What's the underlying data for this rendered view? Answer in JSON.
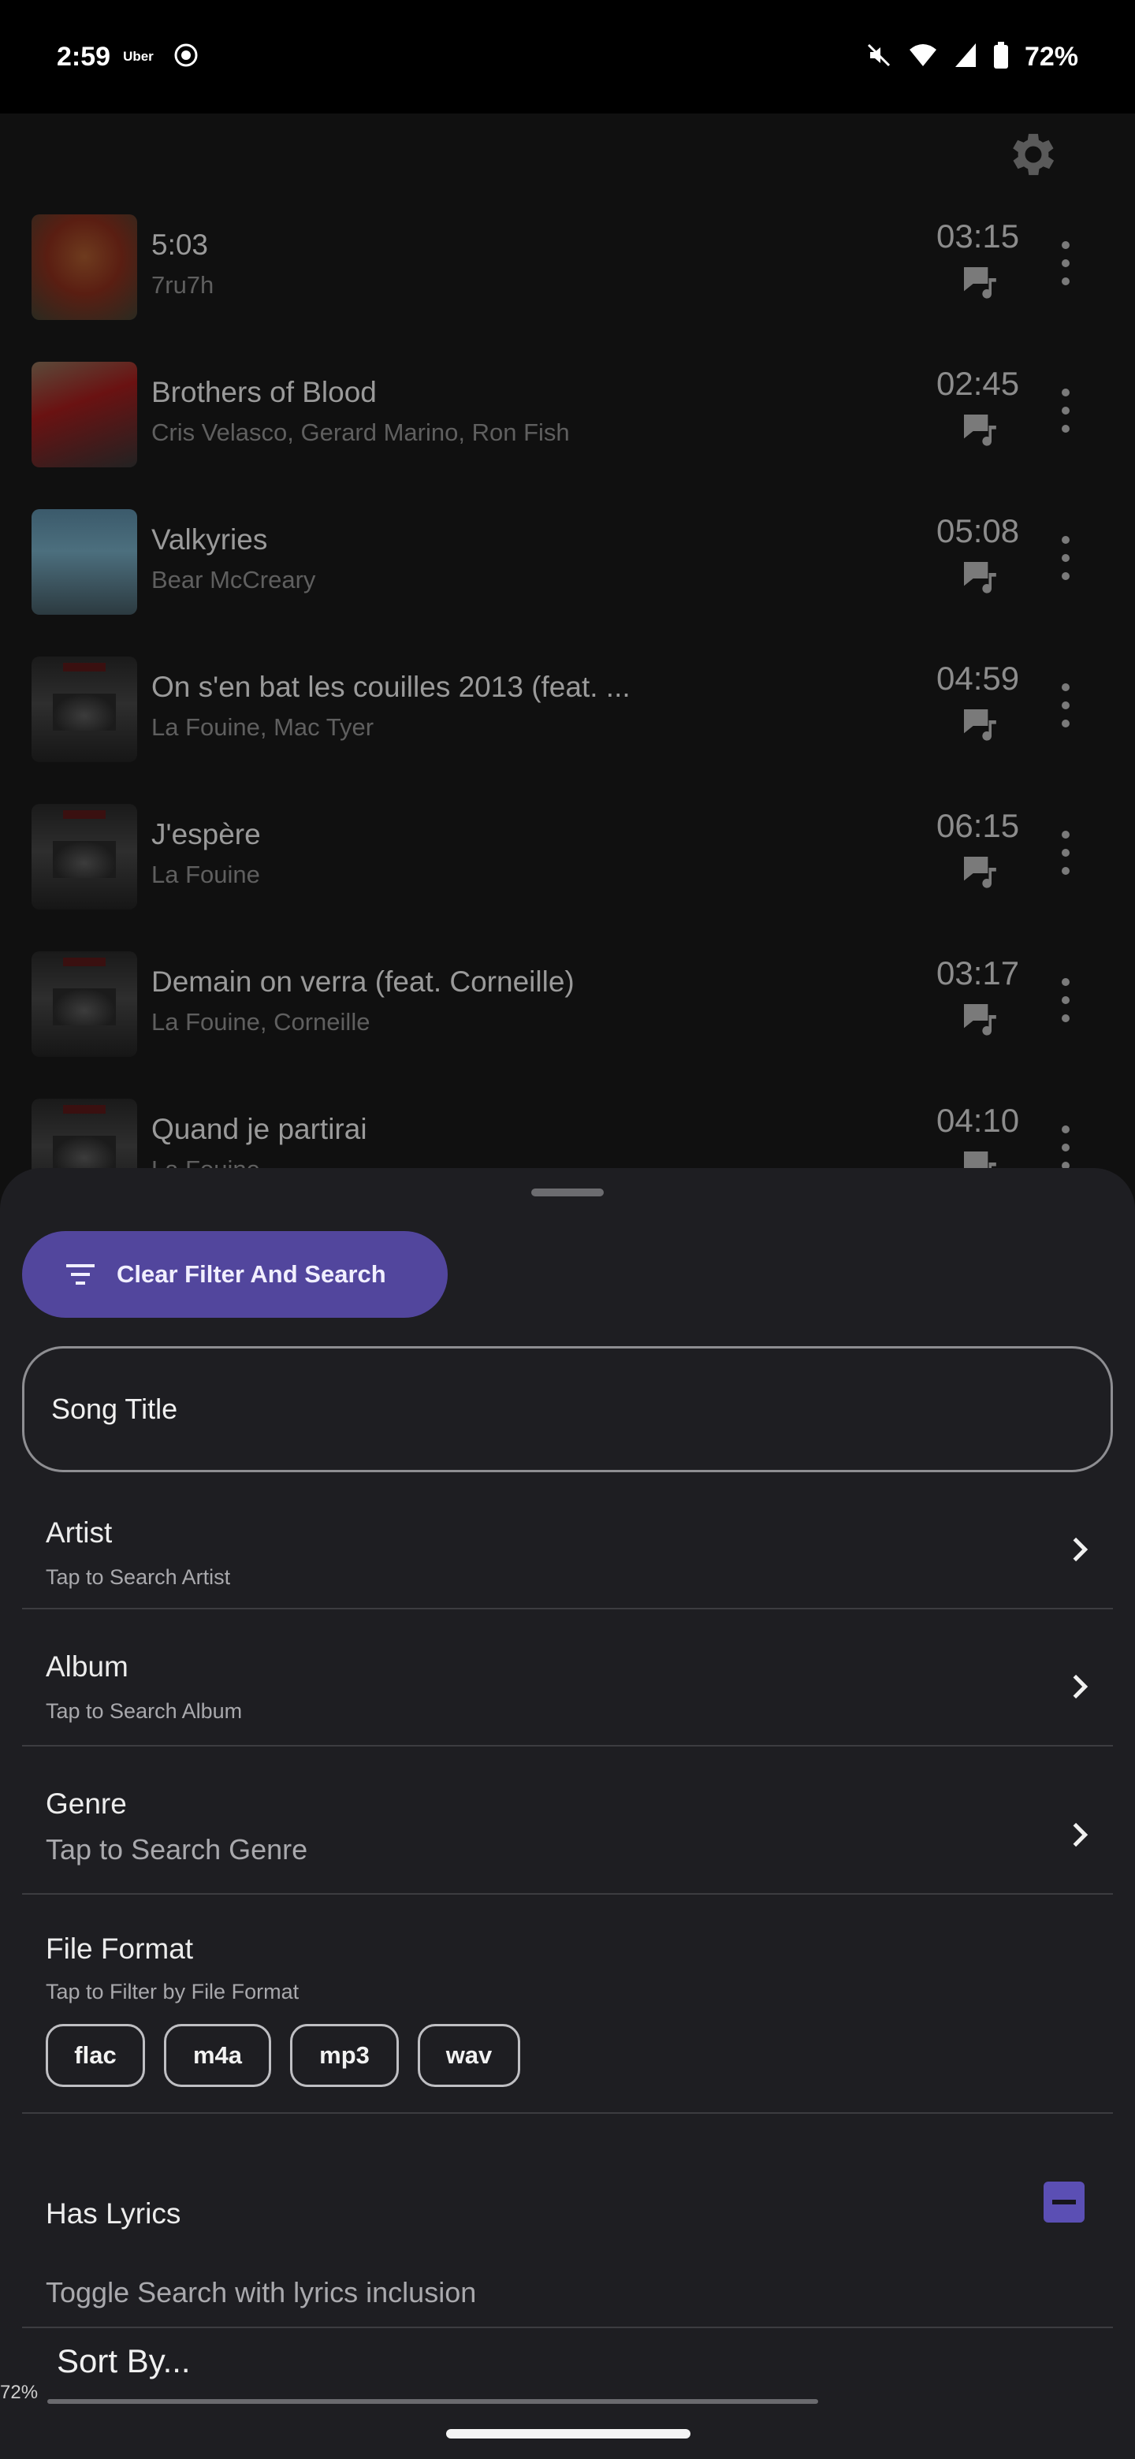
{
  "status_bar": {
    "time": "2:59",
    "app_label": "Uber",
    "battery": "72%"
  },
  "toolbar": {
    "settings_icon": "gear-icon"
  },
  "songs": [
    {
      "title": "5:03",
      "artist": "7ru7h",
      "duration": "03:15",
      "art": "art-red"
    },
    {
      "title": "Brothers of Blood",
      "artist": "Cris Velasco, Gerard Marino, Ron Fish",
      "duration": "02:45",
      "art": "art-gow"
    },
    {
      "title": "Valkyries",
      "artist": "Bear McCreary",
      "duration": "05:08",
      "art": "art-val"
    },
    {
      "title": "On s'en bat les couilles 2013 (feat. ...",
      "artist": "La Fouine, Mac Tyer",
      "duration": "04:59",
      "art": "art-dark"
    },
    {
      "title": "J'espère",
      "artist": "La Fouine",
      "duration": "06:15",
      "art": "art-dark"
    },
    {
      "title": "Demain on verra (feat. Corneille)",
      "artist": "La Fouine, Corneille",
      "duration": "03:17",
      "art": "art-dark"
    },
    {
      "title": "Quand je partirai",
      "artist": "La Fouine",
      "duration": "04:10",
      "art": "art-dark"
    }
  ],
  "sheet": {
    "clear_button": "Clear Filter And Search",
    "song_title_field": "Song Title",
    "artist": {
      "title": "Artist",
      "subtitle": "Tap to Search Artist"
    },
    "album": {
      "title": "Album",
      "subtitle": "Tap to Search Album"
    },
    "genre": {
      "title": "Genre",
      "subtitle": "Tap to Search Genre"
    },
    "file_format": {
      "title": "File Format",
      "subtitle": "Tap to Filter by File Format",
      "chips": [
        "flac",
        "m4a",
        "mp3",
        "wav"
      ]
    },
    "has_lyrics": {
      "title": "Has Lyrics",
      "subtitle": "Toggle Search with lyrics inclusion"
    },
    "sort_by": "Sort By...",
    "zoom_percent": "72%"
  },
  "colors": {
    "accent": "#52469d",
    "sheet_bg": "#1e1e22",
    "list_bg": "#101010"
  }
}
